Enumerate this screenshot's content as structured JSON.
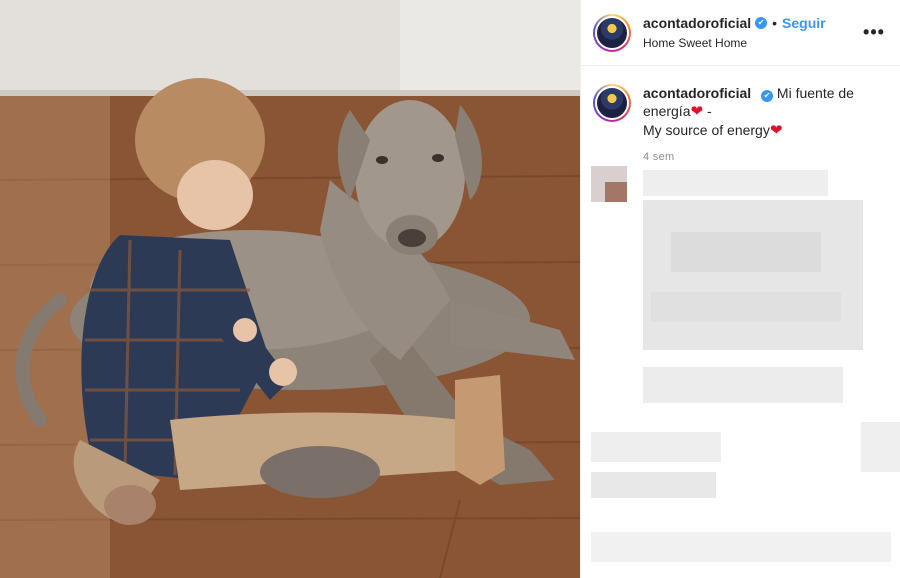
{
  "post": {
    "author": {
      "username": "acontadoroficial",
      "verified_mark": "✔",
      "follow_label": "Seguir",
      "location": "Home Sweet Home"
    },
    "more_label": "•••",
    "caption": {
      "username": "acontadoroficial",
      "line1": "Mi fuente de energía",
      "line2": "My source of energy",
      "separator": " -",
      "heart_icon": "❤"
    },
    "time_ago": "4 sem"
  },
  "colors": {
    "accent": "#3897f0",
    "heart": "#e0112b",
    "muted": "#8e8e8e"
  }
}
